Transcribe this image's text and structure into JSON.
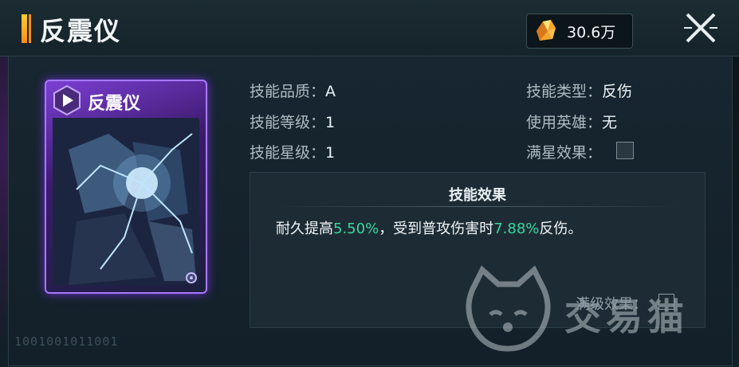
{
  "header": {
    "title": "反震仪",
    "currency_value": "30.6万",
    "currency_icon": "crystal-icon",
    "close_icon": "close-icon"
  },
  "card": {
    "name": "反震仪",
    "emblem_icon": "play-emblem-icon",
    "rarity_color": "#7b3fd3",
    "serial": "1001001011001"
  },
  "info": {
    "quality_label": "技能品质：",
    "quality_value": "A",
    "level_label": "技能等级：",
    "level_value": "1",
    "star_label": "技能星级：",
    "star_value": "1",
    "type_label": "技能类型：",
    "type_value": "反伤",
    "hero_label": "使用英雄：",
    "hero_value": "无",
    "maxstar_label": "满星效果："
  },
  "effect": {
    "title": "技能效果",
    "part1": "耐久提高",
    "value1": "5.50%",
    "part2": "，受到普攻伤害时",
    "value2": "7.88%",
    "part3": "反伤。",
    "highlight_color": "#39d79e",
    "maxlevel_label": "满级效果："
  },
  "watermark": {
    "text": "交易猫"
  }
}
